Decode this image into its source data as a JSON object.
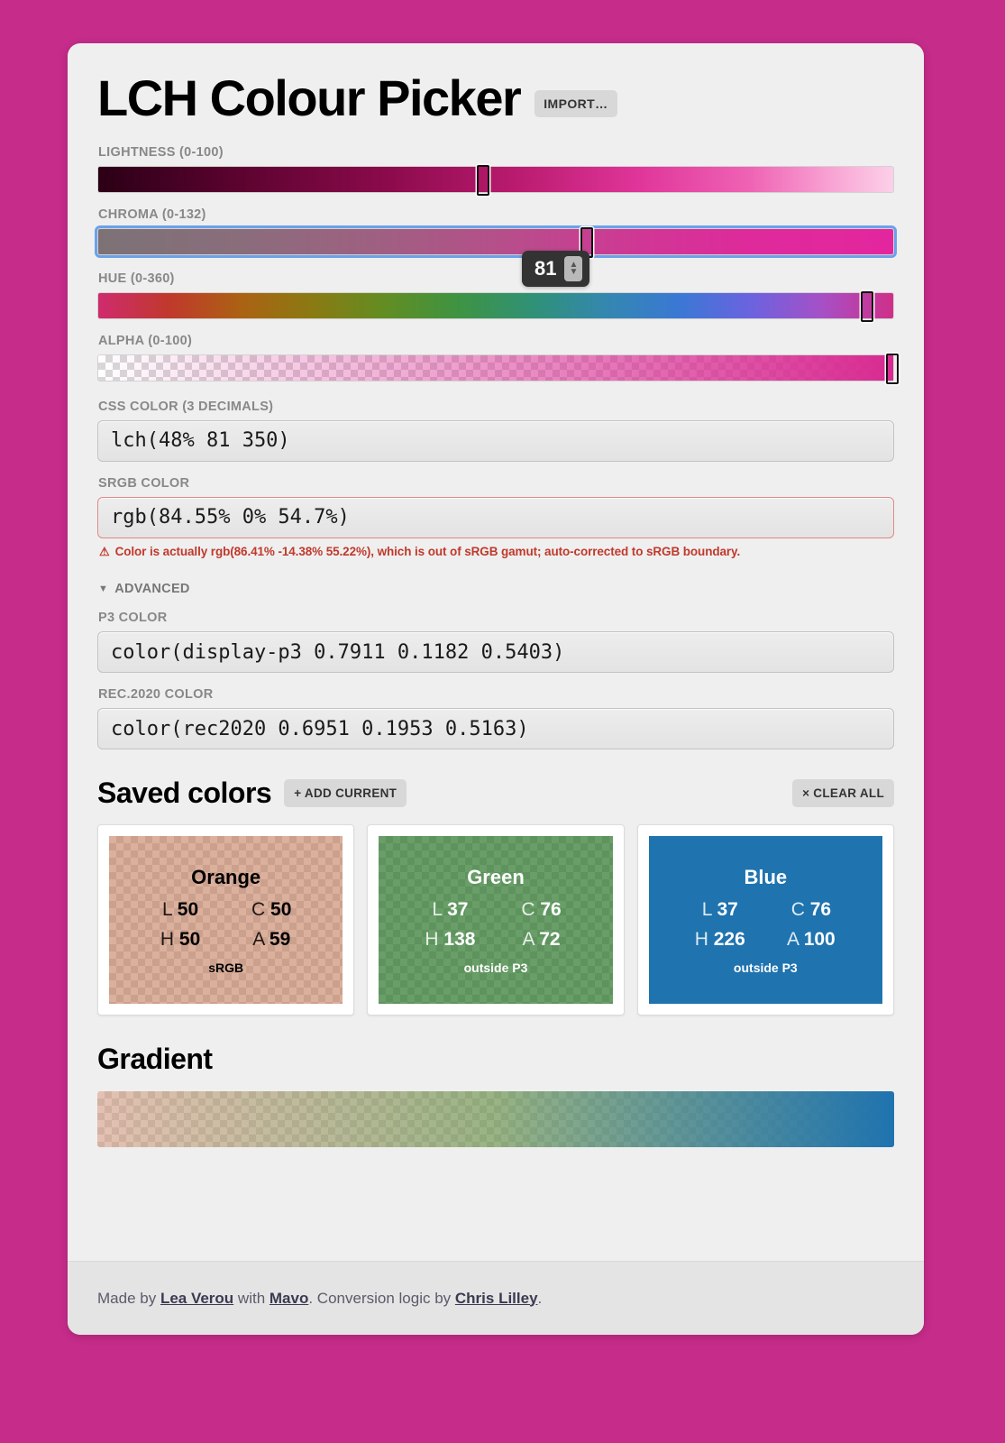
{
  "app": {
    "title": "LCH Colour Picker",
    "import_label": "IMPORT…",
    "background_color": "#c62c8a"
  },
  "sliders": [
    {
      "label": "LIGHTNESS (0-100)",
      "name": "lightness",
      "min": 0,
      "max": 100,
      "value": 48,
      "percent": 48
    },
    {
      "label": "CHROMA (0-132)",
      "name": "chroma",
      "min": 0,
      "max": 132,
      "value": 81,
      "percent": 61.4,
      "focused": true,
      "tooltip": "81"
    },
    {
      "label": "HUE (0-360)",
      "name": "hue",
      "min": 0,
      "max": 360,
      "value": 350,
      "percent": 97.2
    },
    {
      "label": "ALPHA (0-100)",
      "name": "alpha",
      "min": 0,
      "max": 100,
      "value": 100,
      "percent": 100
    }
  ],
  "css_color": {
    "label": "CSS COLOR (3 DECIMALS)",
    "value": "lch(48% 81 350)"
  },
  "srgb_color": {
    "label": "sRGB COLOR",
    "value": "rgb(84.55% 0% 54.7%)",
    "warning_icon": "warning-triangle-icon",
    "warning": "Color is actually rgb(86.41% -14.38% 55.22%), which is out of sRGB gamut; auto-corrected to sRGB boundary.",
    "warning_color": "#c0392b"
  },
  "advanced": {
    "toggle_label": "ADVANCED",
    "caret": "▼",
    "expanded": true,
    "p3": {
      "label": "P3 COLOR",
      "value": "color(display-p3 0.7911 0.1182 0.5403)"
    },
    "rec2020": {
      "label": "REC.2020 COLOR",
      "value": "color(rec2020 0.6951 0.1953 0.5163)"
    }
  },
  "saved_colors": {
    "title": "Saved colors",
    "add_label": "+ ADD CURRENT",
    "clear_label": "× CLEAR ALL",
    "keys": {
      "l": "L",
      "c": "C",
      "h": "H",
      "a": "A"
    },
    "items": [
      {
        "name": "Orange",
        "l": "50",
        "c": "50",
        "h": "50",
        "a": "59",
        "note": "sRGB",
        "color": "rgba(193,120,89,0.59)",
        "text_color": "#000000"
      },
      {
        "name": "Green",
        "l": "37",
        "c": "76",
        "h": "138",
        "a": "72",
        "note": "outside P3",
        "color": "rgba(47,121,47,0.72)",
        "text_color": "#ffffff"
      },
      {
        "name": "Blue",
        "l": "37",
        "c": "76",
        "h": "226",
        "a": "100",
        "note": "outside P3",
        "color": "rgba(31,115,175,1)",
        "text_color": "#ffffff"
      }
    ]
  },
  "gradient": {
    "title": "Gradient"
  },
  "footer": {
    "made_by": "Made by ",
    "author": "Lea Verou",
    "with": " with ",
    "tool": "Mavo",
    "mid": ". Conversion logic by ",
    "logic_author": "Chris Lilley",
    "end": "."
  }
}
